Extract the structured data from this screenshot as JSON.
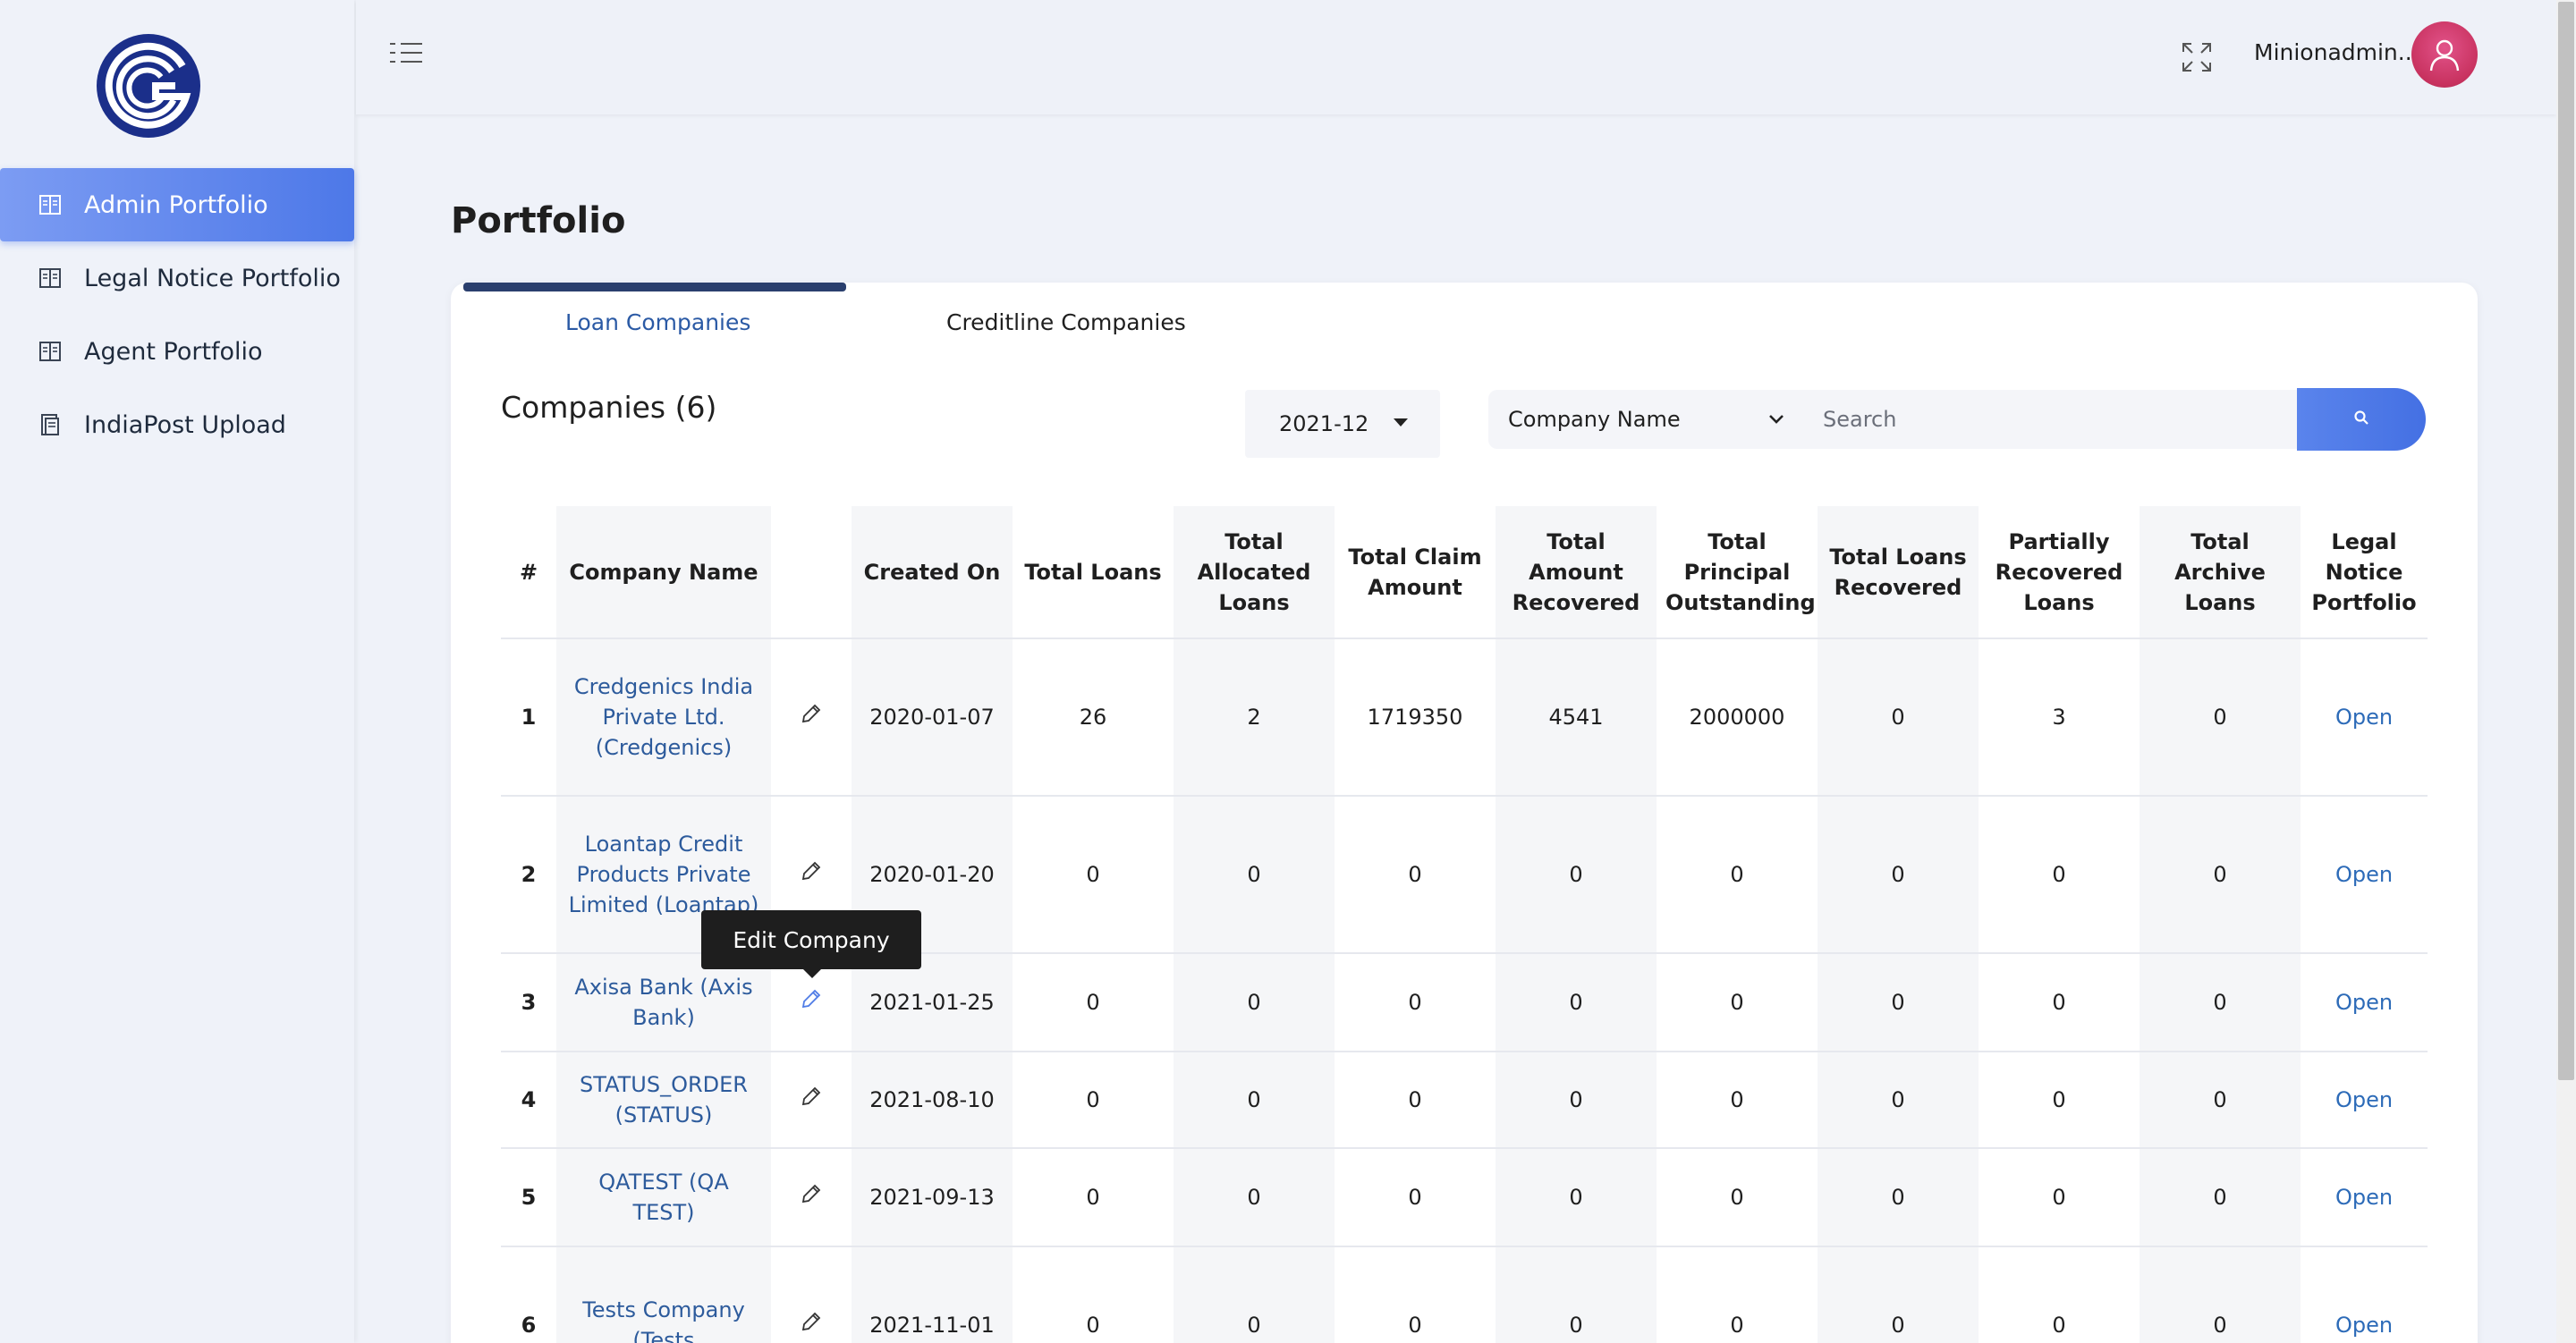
{
  "sidebar": {
    "items": [
      {
        "label": "Admin Portfolio",
        "icon": "book-icon",
        "active": true
      },
      {
        "label": "Legal Notice Portfolio",
        "icon": "book-icon",
        "active": false
      },
      {
        "label": "Agent Portfolio",
        "icon": "book-icon",
        "active": false
      },
      {
        "label": "IndiaPost Upload",
        "icon": "upload-doc-icon",
        "active": false
      }
    ]
  },
  "header": {
    "user_name": "Minionadmin..",
    "icons": [
      "menu-toggle-icon",
      "fullscreen-icon",
      "avatar-icon"
    ]
  },
  "page": {
    "title": "Portfolio",
    "tabs": [
      {
        "label": "Loan Companies",
        "active": true
      },
      {
        "label": "Creditline Companies",
        "active": false
      }
    ],
    "companies_title": "Companies (6)",
    "date_filter": "2021-12",
    "search_field_select": "Company Name",
    "search_placeholder": "Search"
  },
  "table": {
    "headers": [
      "#",
      "Company Name",
      "",
      "Created On",
      "Total Loans",
      "Total Allocated Loans",
      "Total Claim Amount",
      "Total Amount Recovered",
      "Total Principal Outstanding",
      "Total Loans Recovered",
      "Partially Recovered Loans",
      "Total Archive Loans",
      "Legal Notice Portfolio"
    ],
    "rows": [
      {
        "n": "1",
        "company": "Credgenics India Private Ltd. (Credgenics)",
        "created": "2020-01-07",
        "total_loans": "26",
        "allocated": "2",
        "claim": "1719350",
        "recovered_amt": "4541",
        "principal": "2000000",
        "loans_recovered": "0",
        "partial": "3",
        "archive": "0",
        "legal": "Open"
      },
      {
        "n": "2",
        "company": "Loantap Credit Products Private Limited (Loantap)",
        "created": "2020-01-20",
        "total_loans": "0",
        "allocated": "0",
        "claim": "0",
        "recovered_amt": "0",
        "principal": "0",
        "loans_recovered": "0",
        "partial": "0",
        "archive": "0",
        "legal": "Open"
      },
      {
        "n": "3",
        "company": "Axisa Bank (Axis Bank)",
        "created": "2021-01-25",
        "total_loans": "0",
        "allocated": "0",
        "claim": "0",
        "recovered_amt": "0",
        "principal": "0",
        "loans_recovered": "0",
        "partial": "0",
        "archive": "0",
        "legal": "Open"
      },
      {
        "n": "4",
        "company": "STATUS_ORDER (STATUS)",
        "created": "2021-08-10",
        "total_loans": "0",
        "allocated": "0",
        "claim": "0",
        "recovered_amt": "0",
        "principal": "0",
        "loans_recovered": "0",
        "partial": "0",
        "archive": "0",
        "legal": "Open"
      },
      {
        "n": "5",
        "company": "QATEST (QA TEST)",
        "created": "2021-09-13",
        "total_loans": "0",
        "allocated": "0",
        "claim": "0",
        "recovered_amt": "0",
        "principal": "0",
        "loans_recovered": "0",
        "partial": "0",
        "archive": "0",
        "legal": "Open"
      },
      {
        "n": "6",
        "company": "Tests Company (Tests",
        "created": "2021-11-01",
        "total_loans": "0",
        "allocated": "0",
        "claim": "0",
        "recovered_amt": "0",
        "principal": "0",
        "loans_recovered": "0",
        "partial": "0",
        "archive": "0",
        "legal": "Open"
      }
    ]
  },
  "tooltip": {
    "text": "Edit Company"
  },
  "colors": {
    "accent": "#4d78e8",
    "link": "#2d5b9c",
    "tab_indicator": "#2a3f6e",
    "avatar": "#c8325f"
  }
}
